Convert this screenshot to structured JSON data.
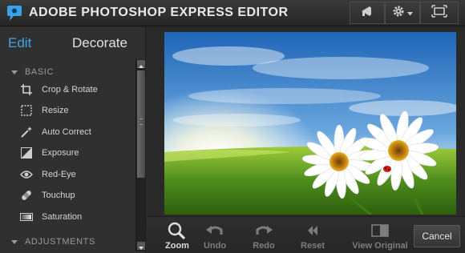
{
  "app": {
    "title": "ADOBE PHOTOSHOP EXPRESS EDITOR"
  },
  "mode_tabs": {
    "edit": "Edit",
    "decorate": "Decorate"
  },
  "sections": {
    "basic": "BASIC",
    "adjustments": "ADJUSTMENTS"
  },
  "basic_tools": [
    {
      "label": "Crop & Rotate",
      "icon": "crop-icon"
    },
    {
      "label": "Resize",
      "icon": "resize-icon"
    },
    {
      "label": "Auto Correct",
      "icon": "magic-wand-icon"
    },
    {
      "label": "Exposure",
      "icon": "exposure-icon"
    },
    {
      "label": "Red-Eye",
      "icon": "eye-icon"
    },
    {
      "label": "Touchup",
      "icon": "bandage-icon"
    },
    {
      "label": "Saturation",
      "icon": "saturation-icon"
    }
  ],
  "toolbar": {
    "zoom": "Zoom",
    "undo": "Undo",
    "redo": "Redo",
    "reset": "Reset",
    "view_original": "View Original",
    "cancel": "Cancel"
  },
  "colors": {
    "accent": "#41a3ea",
    "panel": "#303030",
    "titlebar": "#2e2e2e"
  }
}
